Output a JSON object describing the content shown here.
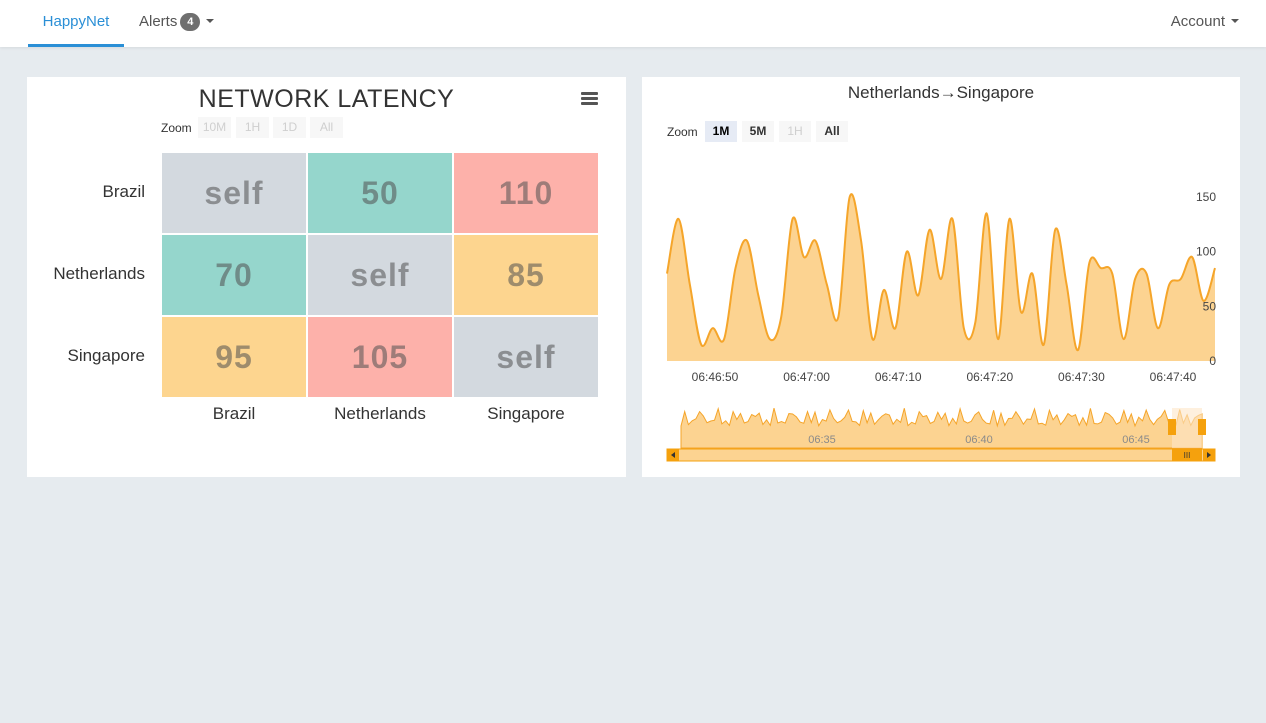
{
  "nav": {
    "brand": "HappyNet",
    "alerts_label": "Alerts",
    "alerts_count": "4",
    "account_label": "Account"
  },
  "colors": {
    "accent": "#2a8fd6",
    "self": "#d3d9df",
    "low": "#95d6cc",
    "mid": "#fdd58f",
    "high": "#fdb1aa",
    "line": "#f5a52a",
    "area": "#fcd391"
  },
  "heatmap": {
    "title": "NETWORK LATENCY",
    "menu_icon": "hamburger-menu-icon",
    "zoom_label": "Zoom",
    "zoom_buttons": [
      "10M",
      "1H",
      "1D",
      "All"
    ]
  },
  "linechart": {
    "title": "Netherlands→Singapore",
    "zoom_label": "Zoom",
    "zoom_buttons": [
      "1M",
      "5M",
      "1H",
      "All"
    ],
    "navigator_labels": [
      "06:35",
      "06:40",
      "06:45"
    ],
    "scrollbar_grip": "III"
  },
  "chart_data": [
    {
      "type": "heatmap",
      "title": "NETWORK LATENCY",
      "x_categories": [
        "Brazil",
        "Netherlands",
        "Singapore"
      ],
      "y_categories": [
        "Brazil",
        "Netherlands",
        "Singapore"
      ],
      "cells": [
        {
          "row": 0,
          "col": 0,
          "label": "self",
          "level": "self"
        },
        {
          "row": 0,
          "col": 1,
          "label": "50",
          "value": 50,
          "level": "low"
        },
        {
          "row": 0,
          "col": 2,
          "label": "110",
          "value": 110,
          "level": "high"
        },
        {
          "row": 1,
          "col": 0,
          "label": "70",
          "value": 70,
          "level": "low"
        },
        {
          "row": 1,
          "col": 1,
          "label": "self",
          "level": "self"
        },
        {
          "row": 1,
          "col": 2,
          "label": "85",
          "value": 85,
          "level": "mid"
        },
        {
          "row": 2,
          "col": 0,
          "label": "95",
          "value": 95,
          "level": "mid"
        },
        {
          "row": 2,
          "col": 1,
          "label": "105",
          "value": 105,
          "level": "high"
        },
        {
          "row": 2,
          "col": 2,
          "label": "self",
          "level": "self"
        }
      ]
    },
    {
      "type": "area",
      "title": "Netherlands→Singapore",
      "x_ticks": [
        "06:46:50",
        "06:47:00",
        "06:47:10",
        "06:47:20",
        "06:47:30",
        "06:47:40"
      ],
      "y_ticks": [
        0,
        50,
        100,
        150
      ],
      "ylim": [
        0,
        150
      ],
      "y_axis_side": "right",
      "grid": false,
      "x_start_seconds": 47,
      "x_step_seconds": 1,
      "values": [
        80,
        130,
        70,
        15,
        30,
        20,
        85,
        110,
        60,
        20,
        40,
        130,
        95,
        110,
        70,
        40,
        150,
        110,
        20,
        65,
        30,
        100,
        60,
        120,
        75,
        130,
        30,
        35,
        135,
        20,
        130,
        45,
        80,
        15,
        120,
        70,
        10,
        90,
        85,
        80,
        20,
        75,
        80,
        30,
        70,
        75,
        95,
        55,
        85
      ]
    }
  ]
}
